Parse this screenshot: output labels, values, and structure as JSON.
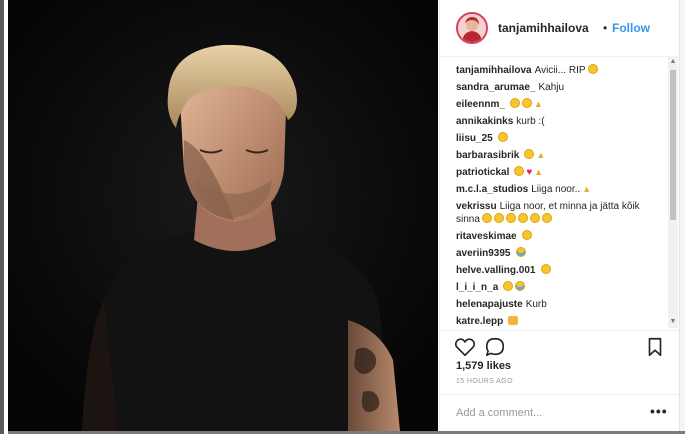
{
  "post": {
    "username": "tanjamihhailova",
    "follow_label": "Follow",
    "separator": "•",
    "likes": "1,579 likes",
    "time": "15 HOURS AGO",
    "add_comment_placeholder": "Add a comment...",
    "more_label": "•••"
  },
  "comments": [
    {
      "user": "tanjamihhailova",
      "text": "Avicii... RIP",
      "emoji": [
        "sad"
      ]
    },
    {
      "user": "sandra_arumae_",
      "text": "Kahju",
      "emoji": []
    },
    {
      "user": "eileennm_",
      "text": "",
      "emoji": [
        "sad",
        "sad",
        "pray"
      ]
    },
    {
      "user": "annikakinks",
      "text": "kurb :(",
      "emoji": []
    },
    {
      "user": "liisu_25",
      "text": "",
      "emoji": [
        "sad"
      ]
    },
    {
      "user": "barbarasibrik",
      "text": "",
      "emoji": [
        "sad",
        "hands"
      ]
    },
    {
      "user": "patriotickal",
      "text": "",
      "emoji": [
        "sad",
        "heart",
        "pray"
      ]
    },
    {
      "user": "m.c.l.a_studios",
      "text": "Liiga noor..",
      "emoji": [
        "pray"
      ]
    },
    {
      "user": "vekrissu",
      "text": "Liiga noor, et minna ja jätta kõik sinna",
      "emoji": [
        "sad",
        "sad",
        "sad",
        "sad",
        "sad",
        "sad"
      ]
    },
    {
      "user": "ritaveskimae",
      "text": "",
      "emoji": [
        "sad"
      ]
    },
    {
      "user": "averiin9395",
      "text": "",
      "emoji": [
        "cry"
      ]
    },
    {
      "user": "helve.valling.001",
      "text": "",
      "emoji": [
        "sad"
      ]
    },
    {
      "user": "l_i_i_n_a",
      "text": "",
      "emoji": [
        "sad",
        "cry"
      ]
    },
    {
      "user": "helenapajuste",
      "text": "Kurb",
      "emoji": []
    },
    {
      "user": "katre.lepp",
      "text": "",
      "emoji": [
        "cat"
      ]
    }
  ],
  "icons": {
    "like": "heart-outline-icon",
    "comment": "speech-bubble-icon",
    "save": "bookmark-icon"
  },
  "colors": {
    "follow": "#3897f0",
    "text": "#262626",
    "muted": "#999999",
    "photo_bg": "#0b0b0b"
  }
}
